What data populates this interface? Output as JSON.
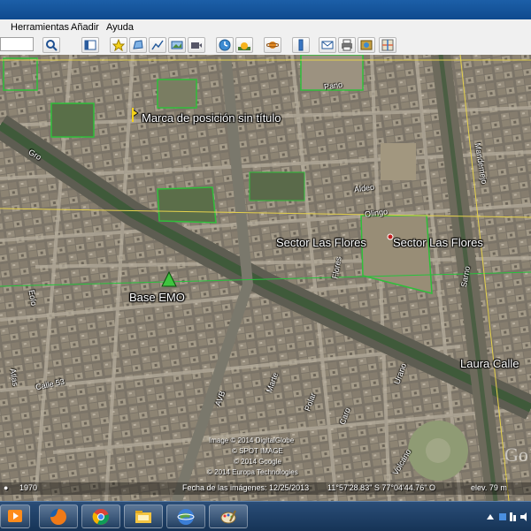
{
  "menu": {
    "items": [
      "Herramientas",
      "Añadir",
      "Ayuda"
    ]
  },
  "toolbar": {
    "search_value": "",
    "buttons": [
      "search-icon",
      "sidebar-icon",
      "placemark-icon",
      "polygon-icon",
      "path-icon",
      "image-overlay-icon",
      "record-tour-icon",
      "historical-imagery-icon",
      "sunlight-icon",
      "planets-icon",
      "ruler-icon",
      "email-icon",
      "print-icon",
      "save-image-icon"
    ]
  },
  "map": {
    "placemark_label": "Marca de posición sin título",
    "base_label": "Base EMO",
    "sector_label_1": "Sector Las Flores",
    "sector_label_2": "Sector Las Flores",
    "laura_label": "Laura Calle",
    "streets": {
      "atlas": "Atlas",
      "calle53": "Calle 53",
      "avb": "AVB",
      "marte": "Marte",
      "polar": "Polar",
      "caro": "Caro",
      "volcano": "Volcano",
      "urano": "Urano",
      "olingo": "Olingo",
      "aldeo": "Aldeo",
      "pano": "Pano",
      "gro": "Gro",
      "sarno": "Sarno",
      "flores": "Flores",
      "eolo": "Eolo",
      "mandemejo": "Mandemejo"
    },
    "credits": [
      "Image © 2014 DigitalGlobe",
      "© SPOT IMAGE",
      "© 2014 Google",
      "© 2014 Europa Technologies"
    ],
    "watermark": "Go",
    "year": "1970"
  },
  "status": {
    "imagery_date": "Fecha de las imágenes: 12/25/2013",
    "coordinates": "11°57'28.83\" S  77°04'44.76\" O",
    "elevation": "elev.   79 m"
  },
  "taskbar": {
    "apps": [
      "media-player-icon",
      "firefox-icon",
      "chrome-icon",
      "file-explorer-icon",
      "google-earth-icon",
      "paint-icon"
    ]
  }
}
